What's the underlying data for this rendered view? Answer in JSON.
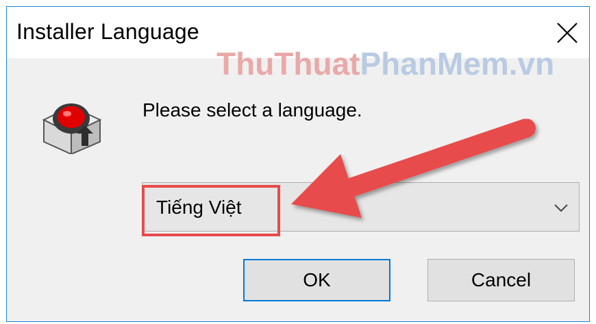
{
  "window": {
    "title": "Installer Language",
    "close_symbol": "✕"
  },
  "watermark": {
    "part_a": "ThuThuat",
    "part_b": "PhanMem.vn"
  },
  "dialog": {
    "icon": "installer-box-icon",
    "prompt": "Please select a language."
  },
  "language_select": {
    "selected": "Tiếng Việt",
    "chevron": "chevron-down-icon"
  },
  "buttons": {
    "ok_label": "OK",
    "cancel_label": "Cancel"
  },
  "annotation": {
    "arrow_color": "#e84b4b",
    "highlight_color": "#e84b4b"
  }
}
